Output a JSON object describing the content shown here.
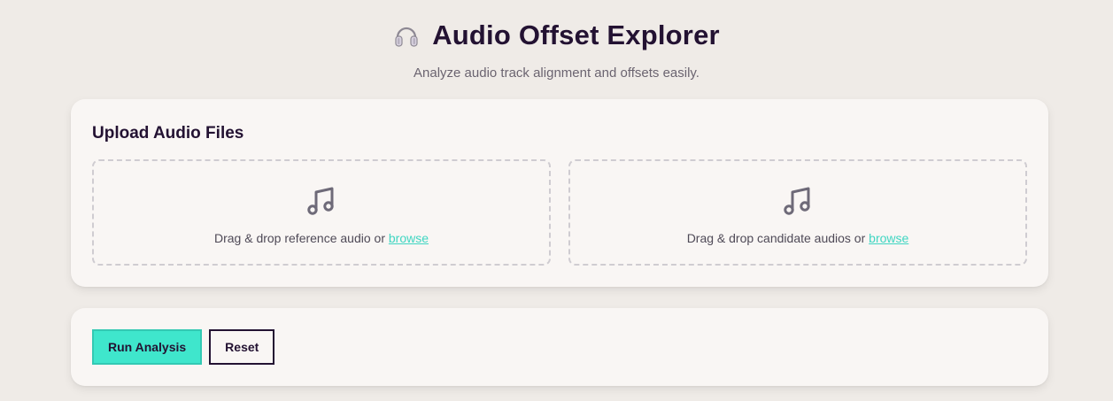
{
  "header": {
    "icon": "headphones-icon",
    "title": "Audio Offset Explorer",
    "subtitle": "Analyze audio track alignment and offsets easily."
  },
  "upload": {
    "title": "Upload Audio Files",
    "reference": {
      "icon": "music-note-icon",
      "text": "Drag & drop reference audio or ",
      "link": "browse"
    },
    "candidate": {
      "icon": "music-note-icon",
      "text": "Drag & drop candidate audios or ",
      "link": "browse"
    }
  },
  "actions": {
    "run_label": "Run Analysis",
    "reset_label": "Reset"
  },
  "colors": {
    "accent": "#3fe6cc",
    "link": "#3fd6c2",
    "text_dark": "#231232",
    "background": "#efebe7",
    "card": "#f9f6f4"
  }
}
